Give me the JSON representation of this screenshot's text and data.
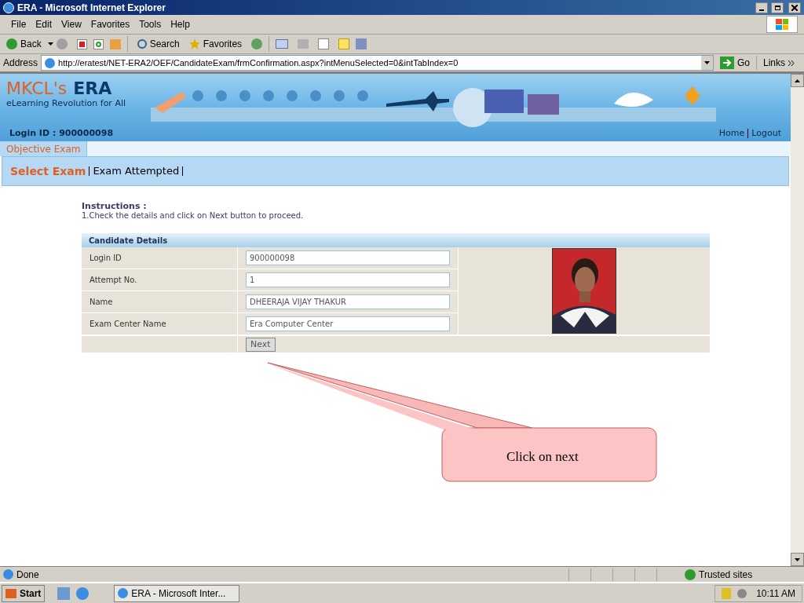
{
  "window": {
    "title": "ERA - Microsoft Internet Explorer"
  },
  "menu": [
    "File",
    "Edit",
    "View",
    "Favorites",
    "Tools",
    "Help"
  ],
  "toolbar": {
    "back": "Back",
    "search": "Search",
    "favorites": "Favorites"
  },
  "address": {
    "label": "Address",
    "url": "http://eratest/NET-ERA2/OEF/CandidateExam/frmConfirmation.aspx?intMenuSelected=0&intTabIndex=0",
    "go": "Go",
    "links": "Links"
  },
  "header": {
    "brand": "MKCL's",
    "brand_bold": "ERA",
    "tagline": "eLearning Revolution for All",
    "login": "Login ID : 900000098",
    "links": [
      "Home",
      "Logout"
    ]
  },
  "tabs": [
    {
      "label": "Objective Exam",
      "selected": true
    }
  ],
  "subnav": [
    {
      "label": "Select Exam",
      "selected": true
    },
    {
      "label": "Exam Attempted",
      "selected": false
    }
  ],
  "instructions": {
    "title": "Instructions :",
    "text": "1.Check the details and click on Next button to proceed."
  },
  "candidate": {
    "title": "Candidate Details",
    "fields": [
      {
        "label": "Login ID",
        "value": "900000098"
      },
      {
        "label": "Attempt No.",
        "value": "1"
      },
      {
        "label": "Name",
        "value": "DHEERAJA VIJAY THAKUR"
      },
      {
        "label": "Exam Center Name",
        "value": "Era Computer Center"
      }
    ],
    "button": "Next"
  },
  "callout": "Click on next",
  "status_bar": {
    "text": "Done",
    "zone": "Trusted sites"
  },
  "taskbar": {
    "start": "Start",
    "task": "ERA - Microsoft Inter...",
    "clock": "10:11 AM"
  }
}
